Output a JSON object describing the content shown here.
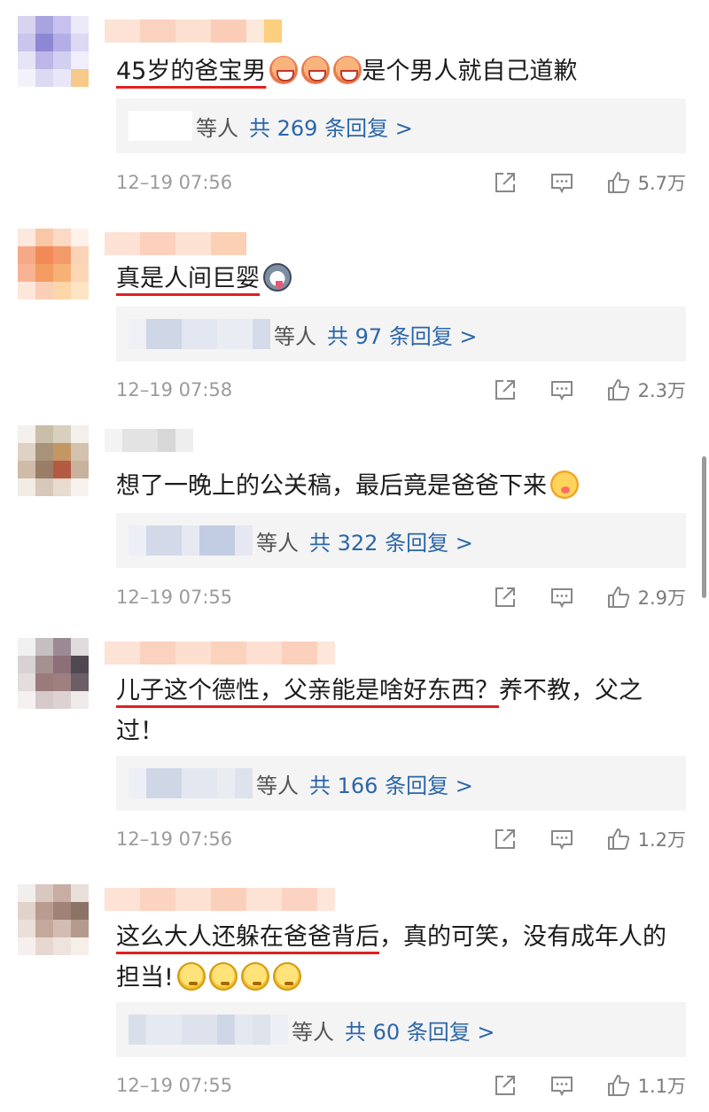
{
  "comments": [
    {
      "text_underlined": "45岁的爸宝男",
      "text_rest": "是个男人就自己道歉",
      "emojis": [
        "laugh",
        "laugh",
        "laugh"
      ],
      "reply": {
        "deng": "等人",
        "link": "共 269 条回复 >"
      },
      "time": "12–19 07:56",
      "likes": "5.7万"
    },
    {
      "text_underlined": "真是人间巨婴",
      "text_rest": "",
      "emojis": [
        "husky"
      ],
      "reply": {
        "deng": "等人",
        "link": "共 97 条回复 >"
      },
      "time": "12–19 07:58",
      "likes": "2.3万"
    },
    {
      "text_underlined": "",
      "text_rest": "想了一晚上的公关稿，最后竟是爸爸下来",
      "emojis": [
        "yum"
      ],
      "reply": {
        "deng": "等人",
        "link": "共 322 条回复 >"
      },
      "time": "12–19 07:55",
      "likes": "2.9万"
    },
    {
      "text_underlined": "儿子这个德性，父亲能是啥好东西？",
      "text_rest": "养不教，父之过！",
      "emojis": [],
      "reply": {
        "deng": "等人",
        "link": "共 166 条回复 >"
      },
      "time": "12–19 07:56",
      "likes": "1.2万"
    },
    {
      "text_underlined": "这么大人还躲在爸爸背后",
      "text_rest": "，真的可笑，没有成年人的担当!",
      "emojis": [
        "think",
        "think",
        "think",
        "think"
      ],
      "reply": {
        "deng": "等人",
        "link": "共 60 条回复 >"
      },
      "time": "12–19 07:55",
      "likes": "1.1万"
    }
  ],
  "icons": {
    "share": "share-icon",
    "comment": "comment-icon",
    "like": "thumbs-up-icon"
  },
  "colors": {
    "underline": "#e02020",
    "reply_link": "#2b66a8",
    "reply_bg": "#f4f4f4",
    "time": "#9b9b9b"
  }
}
